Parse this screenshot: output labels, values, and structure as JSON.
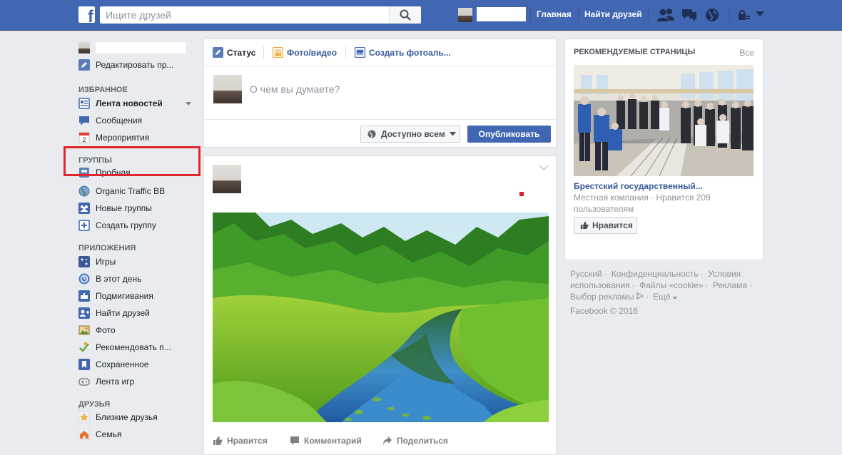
{
  "topbar": {
    "search_placeholder": "Ищите друзей",
    "nav_home": "Главная",
    "nav_find_friends": "Найти друзей"
  },
  "sidebar": {
    "edit_profile": "Редактировать пр...",
    "favorites_heading": "ИЗБРАННОЕ",
    "favorites": [
      {
        "label": "Лента новостей",
        "icon": "news-feed-icon"
      },
      {
        "label": "Сообщения",
        "icon": "messages-icon"
      },
      {
        "label": "Мероприятия",
        "icon": "events-icon",
        "badge": "2"
      }
    ],
    "groups_heading": "ГРУППЫ",
    "groups": [
      {
        "label": "Пробная",
        "icon": "group-icon"
      },
      {
        "label": "Organic Traffic BB",
        "icon": "globe-icon"
      },
      {
        "label": "Новые группы",
        "icon": "new-groups-icon"
      },
      {
        "label": "Создать группу",
        "icon": "create-group-icon"
      }
    ],
    "apps_heading": "ПРИЛОЖЕНИЯ",
    "apps": [
      {
        "label": "Игры",
        "icon": "games-icon"
      },
      {
        "label": "В этот день",
        "icon": "on-this-day-icon"
      },
      {
        "label": "Подмигивания",
        "icon": "pokes-icon"
      },
      {
        "label": "Найти друзей",
        "icon": "find-friends-icon"
      },
      {
        "label": "Фото",
        "icon": "photos-icon"
      },
      {
        "label": "Рекомендовать п...",
        "icon": "recommend-icon"
      },
      {
        "label": "Сохраненное",
        "icon": "saved-icon"
      },
      {
        "label": "Лента игр",
        "icon": "games-feed-icon"
      }
    ],
    "friends_heading": "ДРУЗЬЯ",
    "friends": [
      {
        "label": "Близкие друзья",
        "icon": "close-friends-icon"
      },
      {
        "label": "Семья",
        "icon": "family-icon"
      }
    ]
  },
  "composer": {
    "tab_status": "Статус",
    "tab_photo": "Фото/видео",
    "tab_album": "Создать фотоаль...",
    "placeholder": "О чем вы думаете?",
    "privacy": "Доступно всем",
    "publish": "Опубликовать"
  },
  "post": {
    "like": "Нравится",
    "comment": "Комментарий",
    "share": "Поделиться"
  },
  "recommended": {
    "title": "РЕКОМЕНДУЕМЫЕ СТРАНИЦЫ",
    "see_all": "Все",
    "page_name": "Брестский государственный...",
    "page_meta": "Местная компания · Нравится 209 пользователям",
    "like_button": "Нравится"
  },
  "footer": {
    "links": [
      "Русский",
      "Конфиденциальность",
      "Условия использования",
      "Файлы «cookie»",
      "Реклама",
      "Выбор рекламы",
      "Ещё"
    ],
    "copyright": "Facebook © 2016"
  },
  "colors": {
    "brand": "#4267b2",
    "link": "#365899",
    "highlight": "#e0262c"
  }
}
